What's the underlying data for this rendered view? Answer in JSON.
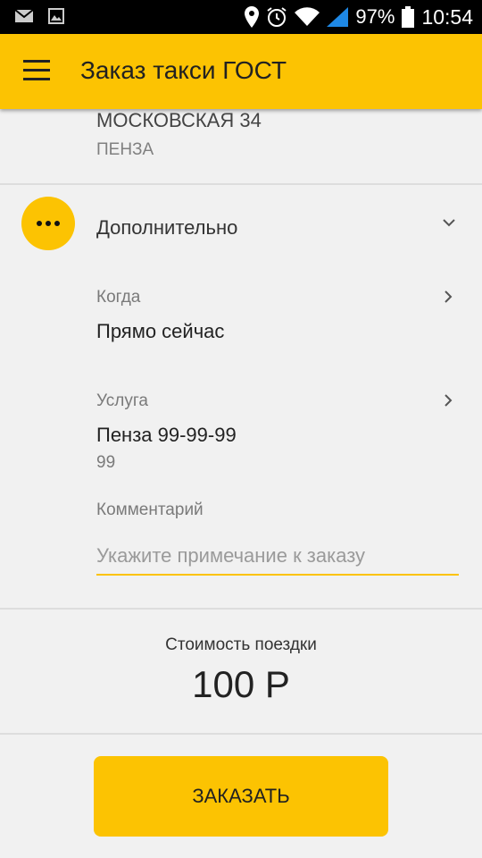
{
  "status_bar": {
    "battery": "97%",
    "time": "10:54",
    "icons": [
      "gmail-icon",
      "gallery-icon",
      "location-icon",
      "alarm-icon",
      "wifi-icon",
      "signal-icon",
      "battery-icon"
    ]
  },
  "app_bar": {
    "title": "Заказ такси ГОСТ",
    "menu_icon": "hamburger-menu-icon"
  },
  "address": {
    "street": "МОСКОВСКАЯ 34",
    "city": "ПЕНЗА"
  },
  "additional": {
    "label": "Дополнительно",
    "icon": "more-dots-icon",
    "expand_icon": "chevron-down-icon"
  },
  "when": {
    "label": "Когда",
    "value": "Прямо сейчас"
  },
  "service": {
    "label": "Услуга",
    "value": "Пенза 99-99-99",
    "sub_value": "99"
  },
  "comment": {
    "label": "Комментарий",
    "placeholder": "Укажите примечание к заказу",
    "value": ""
  },
  "cost": {
    "label": "Стоимость поездки",
    "value": "100 Р"
  },
  "order_button": {
    "label": "ЗАКАЗАТЬ"
  },
  "colors": {
    "accent": "#fcc302",
    "status_bar": "#000000",
    "background": "#f1f1f1"
  }
}
